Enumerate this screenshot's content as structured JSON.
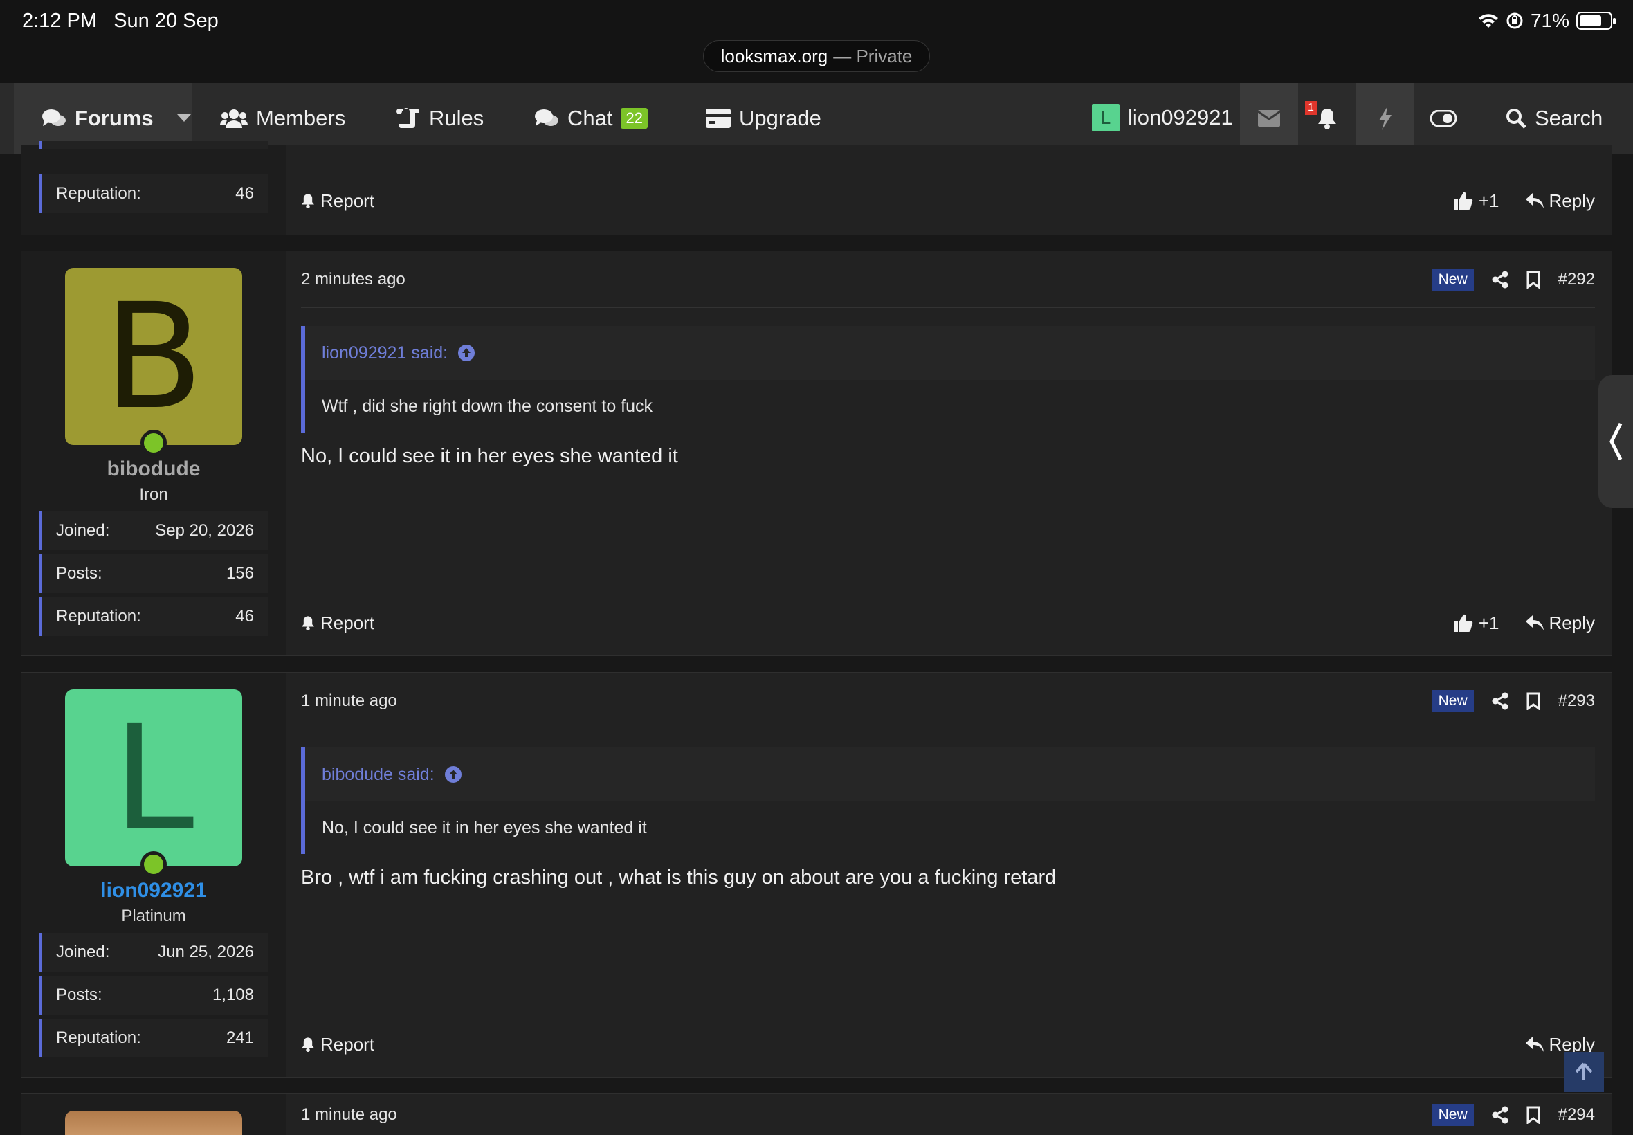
{
  "status_bar": {
    "time": "2:12 PM",
    "date": "Sun 20 Sep",
    "battery": "71%",
    "battery_level": 0.71
  },
  "browser": {
    "domain": "looksmax.org",
    "mode": "— Private"
  },
  "nav": {
    "forums": "Forums",
    "members": "Members",
    "rules": "Rules",
    "chat": "Chat",
    "chat_count": "22",
    "upgrade": "Upgrade",
    "user_initial": "L",
    "username": "lion092921",
    "alerts_count": "1",
    "search": "Search"
  },
  "prev_post": {
    "stat_label": "Reputation:",
    "stat_value": "46",
    "report": "Report",
    "likes": "+1",
    "reply": "Reply"
  },
  "posts": [
    {
      "initial": "B",
      "avatar_bg": "#9d9a32",
      "avatar_fg": "#1e1d05",
      "username": "bibodude",
      "username_color": "#a9a9a9",
      "rank": "Iron",
      "stats": [
        {
          "label": "Joined:",
          "value": "Sep 20, 2026"
        },
        {
          "label": "Posts:",
          "value": "156"
        },
        {
          "label": "Reputation:",
          "value": "46"
        }
      ],
      "time": "2 minutes ago",
      "badge": "New",
      "number": "#292",
      "quote_author": "lion092921 said:",
      "quote_text": "Wtf , did she right down the consent to fuck",
      "message": "No, I could see it in her eyes she wanted it",
      "report": "Report",
      "likes": "+1",
      "reply": "Reply"
    },
    {
      "initial": "L",
      "avatar_bg": "#58d38f",
      "avatar_fg": "#1c5f3c",
      "username": "lion092921",
      "username_color": "#2f8fe6",
      "rank": "Platinum",
      "stats": [
        {
          "label": "Joined:",
          "value": "Jun 25, 2026"
        },
        {
          "label": "Posts:",
          "value": "1,108"
        },
        {
          "label": "Reputation:",
          "value": "241"
        }
      ],
      "time": "1 minute ago",
      "badge": "New",
      "number": "#293",
      "quote_author": "bibodude said:",
      "quote_text": "No, I could see it in her eyes she wanted it",
      "message": "Bro , wtf i am fucking crashing out , what is this guy on about are you a fucking retard",
      "report": "Report",
      "reply": "Reply"
    },
    {
      "time": "1 minute ago",
      "badge": "New",
      "number": "#294"
    }
  ]
}
